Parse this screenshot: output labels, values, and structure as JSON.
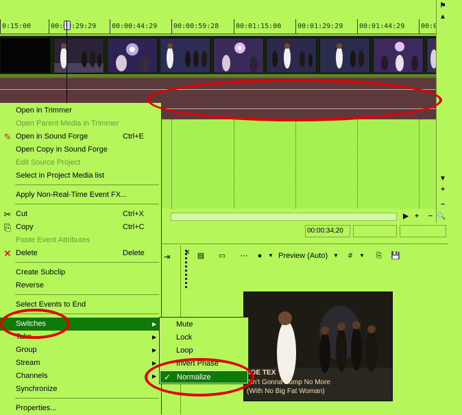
{
  "timeline": {
    "ruler_ticks": [
      "0:15:00",
      "00:00:29:29",
      "00:00:44:29",
      "00:00:59:28",
      "00:01:15:00",
      "00:01:29:29",
      "00:01:44:29",
      "00:0"
    ],
    "current_time": "00:00:34;20"
  },
  "context_menu": {
    "items": [
      {
        "label": "Open in Trimmer",
        "shortcut": "",
        "enabled": true
      },
      {
        "label": "Open Parent Media in Trimmer",
        "shortcut": "",
        "enabled": false
      },
      {
        "label": "Open in Sound Forge",
        "shortcut": "Ctrl+E",
        "enabled": true,
        "icon": "sound-forge-icon"
      },
      {
        "label": "Open Copy in Sound Forge",
        "shortcut": "",
        "enabled": true
      },
      {
        "label": "Edit Source Project",
        "shortcut": "",
        "enabled": false
      },
      {
        "label": "Select in Project Media list",
        "shortcut": "",
        "enabled": true
      },
      {
        "label": "Apply Non-Real-Time Event FX...",
        "shortcut": "",
        "enabled": true
      },
      {
        "label": "Cut",
        "shortcut": "Ctrl+X",
        "enabled": true,
        "icon": "scissors-icon"
      },
      {
        "label": "Copy",
        "shortcut": "Ctrl+C",
        "enabled": true,
        "icon": "copy-icon"
      },
      {
        "label": "Paste Event Attributes",
        "shortcut": "",
        "enabled": false
      },
      {
        "label": "Delete",
        "shortcut": "Delete",
        "enabled": true,
        "icon": "delete-x-icon"
      },
      {
        "label": "Create Subclip",
        "shortcut": "",
        "enabled": true
      },
      {
        "label": "Reverse",
        "shortcut": "",
        "enabled": true
      },
      {
        "label": "Select Events to End",
        "shortcut": "",
        "enabled": true
      },
      {
        "label": "Switches",
        "shortcut": "",
        "enabled": true,
        "submenu": true,
        "highlighted": true
      },
      {
        "label": "Take",
        "shortcut": "",
        "enabled": true,
        "submenu": true
      },
      {
        "label": "Group",
        "shortcut": "",
        "enabled": true,
        "submenu": true
      },
      {
        "label": "Stream",
        "shortcut": "",
        "enabled": true,
        "submenu": true
      },
      {
        "label": "Channels",
        "shortcut": "",
        "enabled": true,
        "submenu": true
      },
      {
        "label": "Synchronize",
        "shortcut": "",
        "enabled": true
      },
      {
        "label": "Properties...",
        "shortcut": "",
        "enabled": true
      }
    ]
  },
  "switches_submenu": {
    "items": [
      {
        "label": "Mute",
        "checked": false
      },
      {
        "label": "Lock",
        "checked": false
      },
      {
        "label": "Loop",
        "checked": false
      },
      {
        "label": "Invert Phase",
        "checked": false
      },
      {
        "label": "Normalize",
        "checked": true,
        "highlighted": true
      }
    ],
    "check_glyph": "✓"
  },
  "preview": {
    "quality_label": "Preview (Auto)",
    "caption_title": "JOE TEX",
    "caption_line1": "Ain't Gonna Bump No More",
    "caption_line2": "(With No Big Fat Woman)"
  },
  "colors": {
    "background": "#b5f75a",
    "highlight": "#0f7a0a",
    "annotation": "#e00000",
    "audio_track": "#5c3a3c"
  }
}
